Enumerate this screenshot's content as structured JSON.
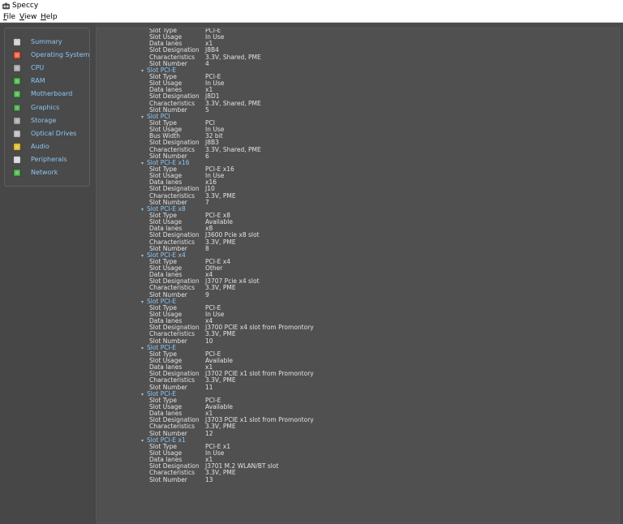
{
  "window": {
    "title": "Speccy"
  },
  "menu": [
    {
      "label": "File",
      "accel": "F",
      "rest": "ile"
    },
    {
      "label": "View",
      "accel": "V",
      "rest": "iew"
    },
    {
      "label": "Help",
      "accel": "H",
      "rest": "elp"
    }
  ],
  "nav": [
    {
      "label": "Summary",
      "icon": "summary-icon",
      "color": "#c8c8c8"
    },
    {
      "label": "Operating System",
      "icon": "windows-icon",
      "color": "#e04b2a"
    },
    {
      "label": "CPU",
      "icon": "cpu-icon",
      "color": "#9a9a9a"
    },
    {
      "label": "RAM",
      "icon": "ram-icon",
      "color": "#3aa43a"
    },
    {
      "label": "Motherboard",
      "icon": "motherboard-icon",
      "color": "#3aa43a"
    },
    {
      "label": "Graphics",
      "icon": "graphics-icon",
      "color": "#3c8c3c"
    },
    {
      "label": "Storage",
      "icon": "storage-icon",
      "color": "#9a9a9a"
    },
    {
      "label": "Optical Drives",
      "icon": "optical-drive-icon",
      "color": "#b0b0b0"
    },
    {
      "label": "Audio",
      "icon": "audio-icon",
      "color": "#d6b21c"
    },
    {
      "label": "Peripherals",
      "icon": "peripherals-icon",
      "color": "#d0d0d0"
    },
    {
      "label": "Network",
      "icon": "network-icon",
      "color": "#3aa43a"
    }
  ],
  "slots": [
    {
      "title": null,
      "fields": [
        [
          "Slot Type",
          "PCI-E"
        ],
        [
          "Slot Usage",
          "In Use"
        ],
        [
          "Data lanes",
          "x1"
        ],
        [
          "Slot Designation",
          "J8B4"
        ],
        [
          "Characteristics",
          "3.3V, Shared, PME"
        ],
        [
          "Slot Number",
          "4"
        ]
      ]
    },
    {
      "title": "Slot PCI-E",
      "fields": [
        [
          "Slot Type",
          "PCI-E"
        ],
        [
          "Slot Usage",
          "In Use"
        ],
        [
          "Data lanes",
          "x1"
        ],
        [
          "Slot Designation",
          "J8D1"
        ],
        [
          "Characteristics",
          "3.3V, Shared, PME"
        ],
        [
          "Slot Number",
          "5"
        ]
      ]
    },
    {
      "title": "Slot PCI",
      "fields": [
        [
          "Slot Type",
          "PCI"
        ],
        [
          "Slot Usage",
          "In Use"
        ],
        [
          "Bus Width",
          "32 bit"
        ],
        [
          "Slot Designation",
          "J8B3"
        ],
        [
          "Characteristics",
          "3.3V, Shared, PME"
        ],
        [
          "Slot Number",
          "6"
        ]
      ]
    },
    {
      "title": "Slot PCI-E x16",
      "fields": [
        [
          "Slot Type",
          "PCI-E x16"
        ],
        [
          "Slot Usage",
          "In Use"
        ],
        [
          "Data lanes",
          "x16"
        ],
        [
          "Slot Designation",
          "J10"
        ],
        [
          "Characteristics",
          "3.3V, PME"
        ],
        [
          "Slot Number",
          "7"
        ]
      ]
    },
    {
      "title": "Slot PCI-E x8",
      "fields": [
        [
          "Slot Type",
          "PCI-E x8"
        ],
        [
          "Slot Usage",
          "Available"
        ],
        [
          "Data lanes",
          "x8"
        ],
        [
          "Slot Designation",
          "J3600 Pcie x8 slot"
        ],
        [
          "Characteristics",
          "3.3V, PME"
        ],
        [
          "Slot Number",
          "8"
        ]
      ]
    },
    {
      "title": "Slot PCI-E x4",
      "fields": [
        [
          "Slot Type",
          "PCI-E x4"
        ],
        [
          "Slot Usage",
          "Other"
        ],
        [
          "Data lanes",
          "x4"
        ],
        [
          "Slot Designation",
          "J3707 Pcie x4 slot"
        ],
        [
          "Characteristics",
          "3.3V, PME"
        ],
        [
          "Slot Number",
          "9"
        ]
      ]
    },
    {
      "title": "Slot PCI-E",
      "fields": [
        [
          "Slot Type",
          "PCI-E"
        ],
        [
          "Slot Usage",
          "In Use"
        ],
        [
          "Data lanes",
          "x4"
        ],
        [
          "Slot Designation",
          "J3700 PCIE x4 slot from Promontory"
        ],
        [
          "Characteristics",
          "3.3V, PME"
        ],
        [
          "Slot Number",
          "10"
        ]
      ]
    },
    {
      "title": "Slot PCI-E",
      "fields": [
        [
          "Slot Type",
          "PCI-E"
        ],
        [
          "Slot Usage",
          "Available"
        ],
        [
          "Data lanes",
          "x1"
        ],
        [
          "Slot Designation",
          "J3702 PCIE x1 slot from Promontory"
        ],
        [
          "Characteristics",
          "3.3V, PME"
        ],
        [
          "Slot Number",
          "11"
        ]
      ]
    },
    {
      "title": "Slot PCI-E",
      "fields": [
        [
          "Slot Type",
          "PCI-E"
        ],
        [
          "Slot Usage",
          "Available"
        ],
        [
          "Data lanes",
          "x1"
        ],
        [
          "Slot Designation",
          "J3703 PCIE x1 slot from Promontory"
        ],
        [
          "Characteristics",
          "3.3V, PME"
        ],
        [
          "Slot Number",
          "12"
        ]
      ]
    },
    {
      "title": "Slot PCI-E x1",
      "fields": [
        [
          "Slot Type",
          "PCI-E x1"
        ],
        [
          "Slot Usage",
          "In Use"
        ],
        [
          "Data lanes",
          "x1"
        ],
        [
          "Slot Designation",
          "J3701 M.2 WLAN/BT slot"
        ],
        [
          "Characteristics",
          "3.3V, PME"
        ],
        [
          "Slot Number",
          "13"
        ]
      ]
    }
  ]
}
